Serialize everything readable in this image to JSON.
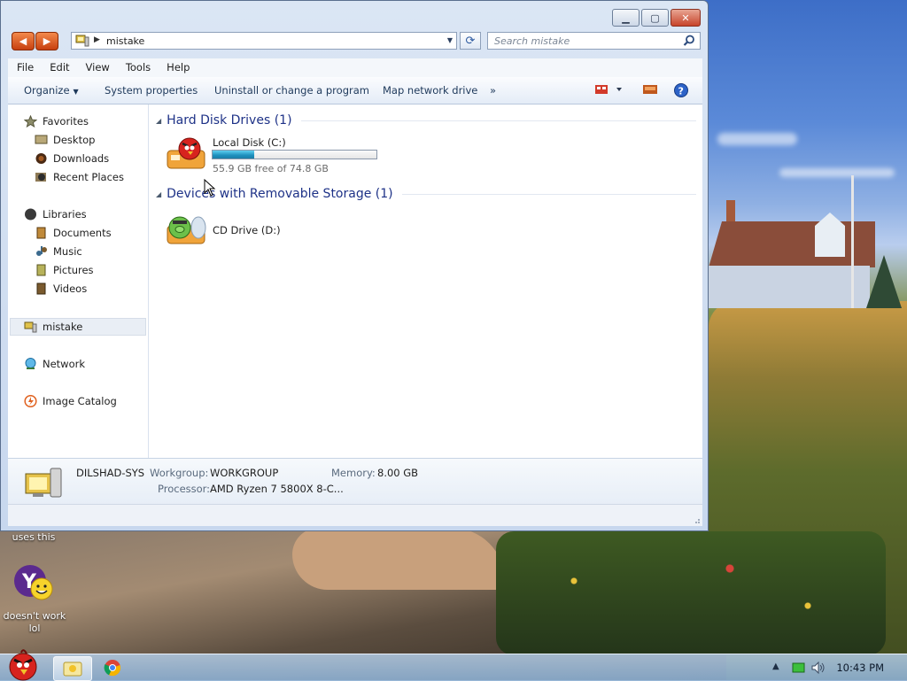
{
  "window": {
    "controls": {
      "minimize": "▁",
      "maximize": "▢",
      "close": "✕"
    },
    "address": {
      "path_label": "mistake"
    },
    "search": {
      "placeholder": "Search mistake"
    },
    "menu": [
      "File",
      "Edit",
      "View",
      "Tools",
      "Help"
    ],
    "commands": {
      "organize": "Organize",
      "system_properties": "System properties",
      "uninstall": "Uninstall or change a program",
      "map_network_drive": "Map network drive",
      "more": "»"
    },
    "nav_pane": {
      "favorites": "Favorites",
      "desktop": "Desktop",
      "downloads": "Downloads",
      "recent": "Recent Places",
      "libraries": "Libraries",
      "documents": "Documents",
      "music": "Music",
      "pictures": "Pictures",
      "videos": "Videos",
      "computer": "mistake",
      "network": "Network",
      "image_catalog": "Image Catalog"
    },
    "groups": {
      "hard_disk": "Hard Disk Drives (1)",
      "removable": "Devices with Removable Storage (1)"
    },
    "drives": {
      "c": {
        "name": "Local Disk (C:)",
        "free_text": "55.9 GB free of 74.8 GB",
        "used_fraction": 0.253
      },
      "d": {
        "name": "CD Drive (D:)"
      }
    },
    "details": {
      "computer_name": "DILSHAD-SYS",
      "workgroup_label": "Workgroup:",
      "workgroup_value": "WORKGROUP",
      "memory_label": "Memory:",
      "memory_value": "8.00 GB",
      "processor_label": "Processor:",
      "processor_value": "AMD Ryzen 7 5800X 8-C..."
    }
  },
  "desktop": {
    "label_top": "uses this",
    "label_bottom": "doesn't work\nlol"
  },
  "taskbar": {
    "clock": "10:43 PM"
  },
  "colors": {
    "accent_blue": "#1e3287",
    "progress": "#1d8fbd",
    "nav_orange": "#e0611f",
    "close_red": "#c7442a"
  }
}
